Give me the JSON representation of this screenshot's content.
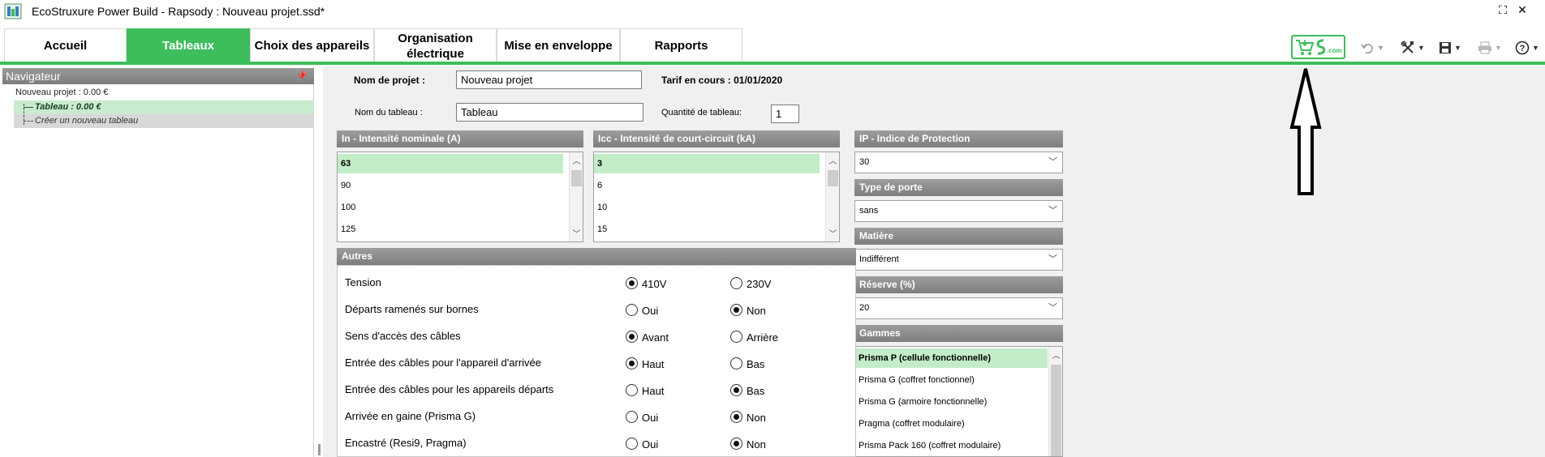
{
  "window": {
    "title": "EcoStruxure Power Build - Rapsody : Nouveau projet.ssd*"
  },
  "tabs": [
    {
      "label": "Accueil",
      "active": false
    },
    {
      "label": "Tableaux",
      "active": true
    },
    {
      "label": "Choix des appareils",
      "active": false
    },
    {
      "label": "Organisation électrique",
      "active": false
    },
    {
      "label": "Mise en enveloppe",
      "active": false
    },
    {
      "label": "Rapports",
      "active": false
    }
  ],
  "toolbar": {
    "store_icon": "cart-se-com-icon",
    "undo_icon": "undo-icon",
    "tools_icon": "tools-icon",
    "save_icon": "save-icon",
    "print_icon": "print-icon",
    "help_icon": "help-icon"
  },
  "navigator": {
    "title": "Navigateur",
    "project": "Nouveau projet : 0.00 €",
    "items": [
      {
        "label": "Tableau : 0.00 €",
        "selected": true
      },
      {
        "label": "Créer un nouveau tableau",
        "selected": false
      }
    ]
  },
  "form": {
    "project_name_label": "Nom de projet :",
    "project_name_value": "Nouveau projet",
    "tarif": "Tarif en cours : 01/01/2020",
    "board_name_label": "Nom du tableau :",
    "board_name_value": "Tableau",
    "quantity_label": "Quantité de tableau:",
    "quantity_value": "1"
  },
  "in_list": {
    "title": "In - Intensité nominale (A)",
    "items": [
      "63",
      "90",
      "100",
      "125"
    ],
    "selected": 0
  },
  "icc_list": {
    "title": "Icc - Intensité de court-circuit (kA)",
    "items": [
      "3",
      "6",
      "10",
      "15"
    ],
    "selected": 0
  },
  "ip": {
    "title": "IP - Indice de Protection",
    "value": "30"
  },
  "porte": {
    "title": "Type de porte",
    "value": "sans"
  },
  "matiere": {
    "title": "Matière",
    "value": "Indifférent"
  },
  "reserve": {
    "title": "Réserve (%)",
    "value": "20"
  },
  "gammes": {
    "title": "Gammes",
    "items": [
      "Prisma P (cellule fonctionnelle)",
      "Prisma G (coffret fonctionnel)",
      "Prisma G (armoire fonctionnelle)",
      "Pragma (coffret modulaire)",
      "Prisma Pack 160 (coffret modulaire)"
    ],
    "selected": 0
  },
  "autres": {
    "title": "Autres",
    "options": [
      {
        "label": "Tension",
        "a": "410V",
        "b": "230V",
        "selected": "a"
      },
      {
        "label": "Départs ramenés sur bornes",
        "a": "Oui",
        "b": "Non",
        "selected": "b"
      },
      {
        "label": "Sens d'accès des câbles",
        "a": "Avant",
        "b": "Arrière",
        "selected": "a"
      },
      {
        "label": "Entrée des câbles pour l'appareil d'arrivée",
        "a": "Haut",
        "b": "Bas",
        "selected": "a"
      },
      {
        "label": "Entrée des câbles pour les appareils départs",
        "a": "Haut",
        "b": "Bas",
        "selected": "b"
      },
      {
        "label": "Arrivée en gaine (Prisma G)",
        "a": "Oui",
        "b": "Non",
        "selected": "b"
      },
      {
        "label": "Encastré (Resi9, Pragma)",
        "a": "Oui",
        "b": "Non",
        "selected": "b"
      }
    ]
  }
}
